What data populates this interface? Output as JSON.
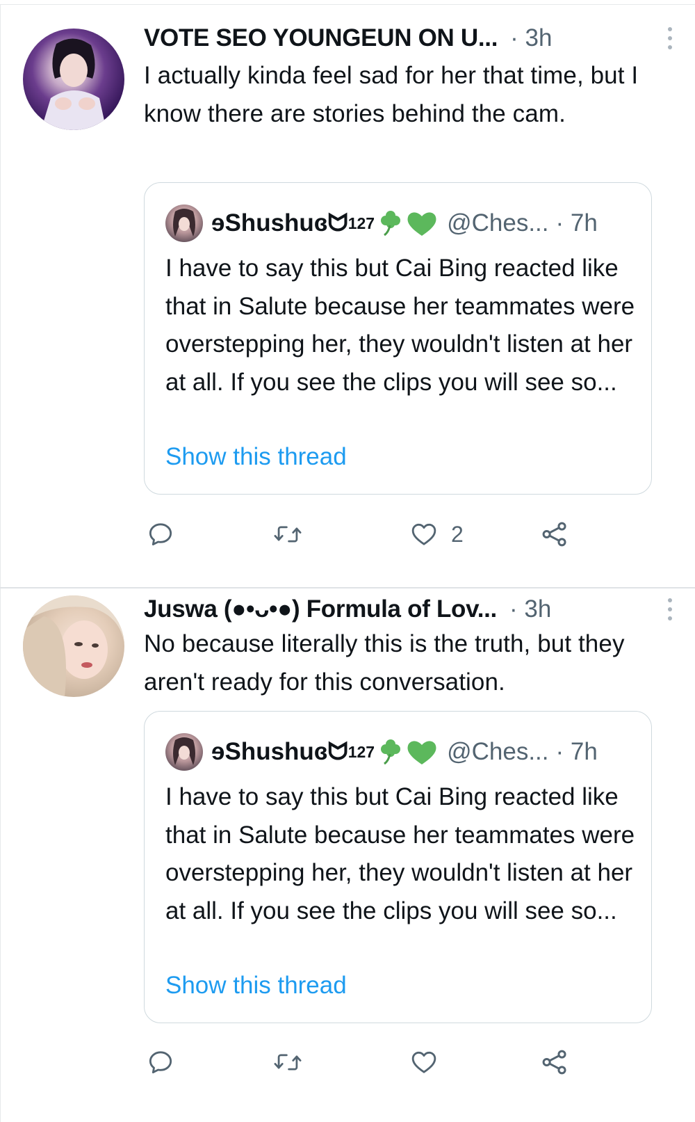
{
  "colors": {
    "text": "#0f1419",
    "secondary": "#536471",
    "link": "#1d9bf0",
    "border": "#cfd9de",
    "accent_green": "#5cb85c"
  },
  "tweets": [
    {
      "author": "VOTE SEO YOUNGEUN ON U...",
      "time": "· 3h",
      "text": "I actually kinda feel sad for her that time, but I know there are stories behind the cam.",
      "avatar_icon": "profile-photo-purple-stage",
      "quote": {
        "name": "ɘShushuɞᗢ",
        "name_sup": "127",
        "handle": "@Ches...",
        "time": "· 7h",
        "text": "I have to say this but Cai Bing reacted like that in Salute because her teammates were overstepping her, they wouldn't listen at her at all. If you see the clips you will see so...",
        "link": "Show this thread"
      },
      "actions": {
        "like_count": "2"
      }
    },
    {
      "author": "Juswa (●•ᴗ•●) Formula of Lov...",
      "time": "· 3h",
      "text": "No because literally this is the truth, but they aren't ready for this conversation.",
      "avatar_icon": "profile-photo-blonde",
      "quote": {
        "name": "ɘShushuɞᗢ",
        "name_sup": "127",
        "handle": "@Ches...",
        "time": "· 7h",
        "text": "I have to say this but Cai Bing reacted like that in Salute because her teammates were overstepping her, they wouldn't listen at her at all. If you see the clips you will see so...",
        "link": "Show this thread"
      },
      "actions": {
        "like_count": ""
      }
    }
  ]
}
